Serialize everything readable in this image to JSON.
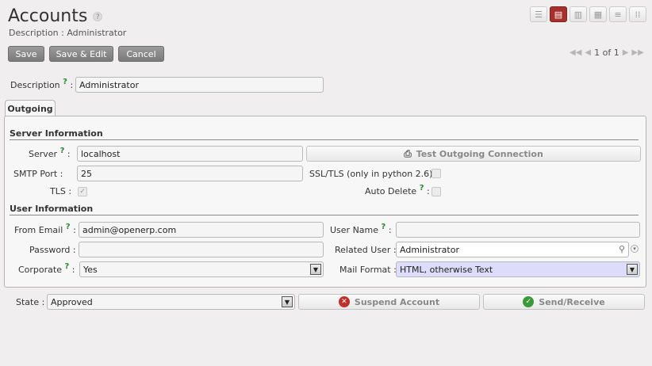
{
  "header": {
    "title": "Accounts",
    "help": "?",
    "subtitle": "Description : Administrator"
  },
  "toolbar": {
    "save_label": "Save",
    "save_edit_label": "Save & Edit",
    "cancel_label": "Cancel"
  },
  "pager": {
    "text": "1 of 1"
  },
  "view_switch": [
    "list-icon",
    "form-icon",
    "graph-icon",
    "calendar-icon",
    "gantt-icon",
    "kanban-icon"
  ],
  "form": {
    "description": {
      "label": "Description",
      "value": "Administrator"
    },
    "tab_outgoing": "Outgoing",
    "server_info_title": "Server Information",
    "server": {
      "label": "Server",
      "value": "localhost"
    },
    "smtp_port": {
      "label": "SMTP Port",
      "value": "25"
    },
    "tls": {
      "label": "TLS :"
    },
    "test_btn": "Test Outgoing Connection",
    "ssl": {
      "label": "SSL/TLS (only in python 2.6) :"
    },
    "auto_delete": {
      "label": "Auto Delete"
    },
    "user_info_title": "User Information",
    "from_email": {
      "label": "From Email",
      "value": "admin@openerp.com"
    },
    "password": {
      "label": "Password :"
    },
    "corporate": {
      "label": "Corporate",
      "value": "Yes"
    },
    "user_name": {
      "label": "User Name",
      "value": ""
    },
    "related_user": {
      "label": "Related User :",
      "value": "Administrator"
    },
    "mail_format": {
      "label": "Mail Format :",
      "value": "HTML, otherwise Text"
    },
    "state": {
      "label": "State :",
      "value": "Approved"
    },
    "suspend_btn": "Suspend Account",
    "send_btn": "Send/Receive"
  },
  "colors": {
    "active_view": "#a8302c",
    "help_mark": "#2a8b2a",
    "suspend_icon": "#c0302c",
    "send_icon": "#3a9a3a"
  }
}
